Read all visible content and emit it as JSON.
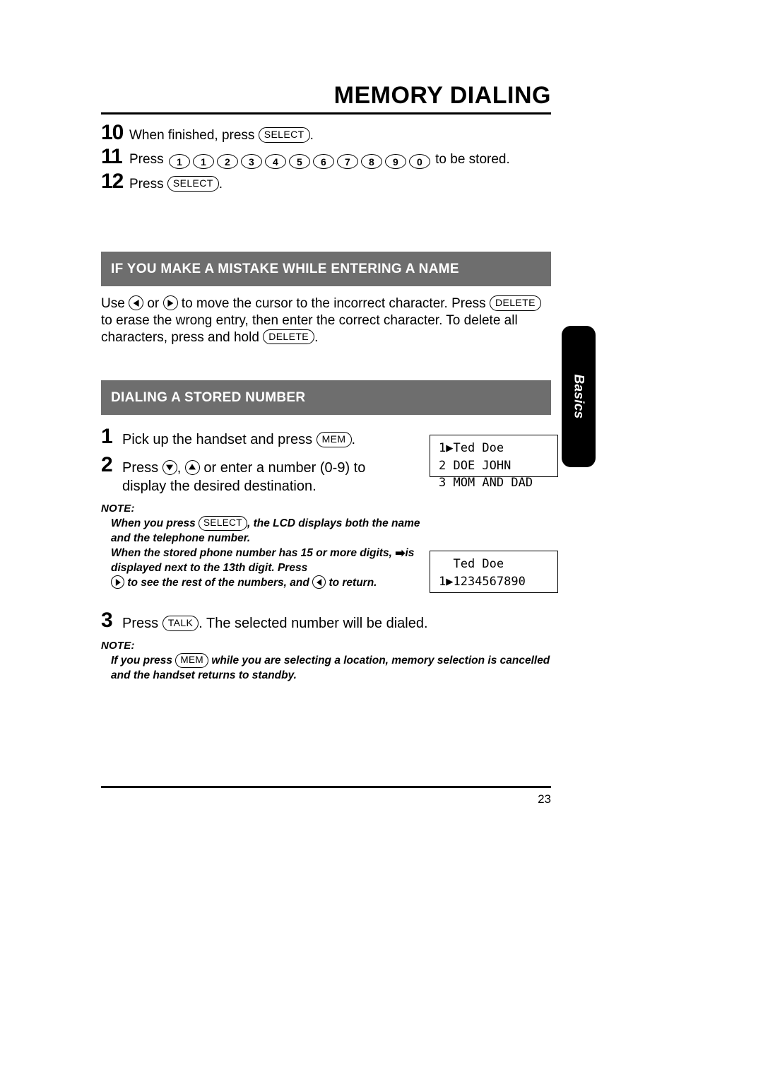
{
  "page": {
    "title": "MEMORY DIALING",
    "number": "23",
    "side_tab": "Basics"
  },
  "top_steps": [
    {
      "num": "10",
      "pre": "When finished, press ",
      "key": "SELECT",
      "post": "."
    },
    {
      "num": "11",
      "pre": "Press ",
      "keys": [
        "1",
        "1",
        "2",
        "3",
        "4",
        "5",
        "6",
        "7",
        "8",
        "9",
        "0"
      ],
      "post": " to be stored."
    },
    {
      "num": "12",
      "pre": "Press ",
      "key": "SELECT",
      "post": "."
    }
  ],
  "mistake_section": {
    "heading": "IF YOU MAKE A MISTAKE WHILE ENTERING A NAME",
    "text_1": "Use ",
    "icon_left": "left-arrow-icon",
    "text_2": " or ",
    "icon_right": "right-arrow-icon",
    "text_3": " to move the cursor to the incorrect character. Press ",
    "key_delete_1": "DELETE",
    "text_4": " to erase the wrong entry, then enter the correct character. To delete all characters, press and hold ",
    "key_delete_2": "DELETE",
    "text_5": "."
  },
  "dialing_section": {
    "heading": "DIALING A STORED NUMBER",
    "steps": [
      {
        "num": "1",
        "pre": "Pick up the handset and press ",
        "key": "MEM",
        "post": "."
      },
      {
        "num": "2",
        "pre": "Press ",
        "mid": ", ",
        "post": " or enter a number (0-9) to display the desired destination."
      },
      {
        "num": "3",
        "pre": "Press ",
        "key": "TALK",
        "post": ".  The selected number will be dialed."
      }
    ]
  },
  "note_1": {
    "heading": "NOTE:",
    "line_1a": "When you press ",
    "line_1_key": "SELECT",
    "line_1b": ", the LCD displays both the name and the telephone number.",
    "line_2a": "When the stored phone number has 15 or more digits, ",
    "line_2_arrow": "➡",
    "line_2b": "is displayed next to the 13th digit.  Press ",
    "line_2c": " to see the rest of the numbers, and ",
    "line_2d": " to return."
  },
  "note_2": {
    "heading": "NOTE:",
    "line_a": "If you press ",
    "key": "MEM",
    "line_b": " while you are selecting a location, memory selection is cancelled and the handset returns to standby."
  },
  "lcd_list": {
    "rows": [
      {
        "index": "1",
        "cursor": "▶",
        "text": "Ted Doe"
      },
      {
        "index": "2",
        "cursor": " ",
        "text": "DOE JOHN"
      },
      {
        "index": "3",
        "cursor": " ",
        "text": "MOM AND DAD"
      }
    ],
    "line_1": "1▶Ted Doe",
    "line_2": "2 DOE JOHN",
    "line_3": "3 MOM AND DAD"
  },
  "lcd_number": {
    "line_1": "  Ted Doe",
    "line_2": "1▶1234567890"
  },
  "colors": {
    "section_bar": "#6e6e6e",
    "side_tab": "#000000",
    "text": "#000000"
  }
}
